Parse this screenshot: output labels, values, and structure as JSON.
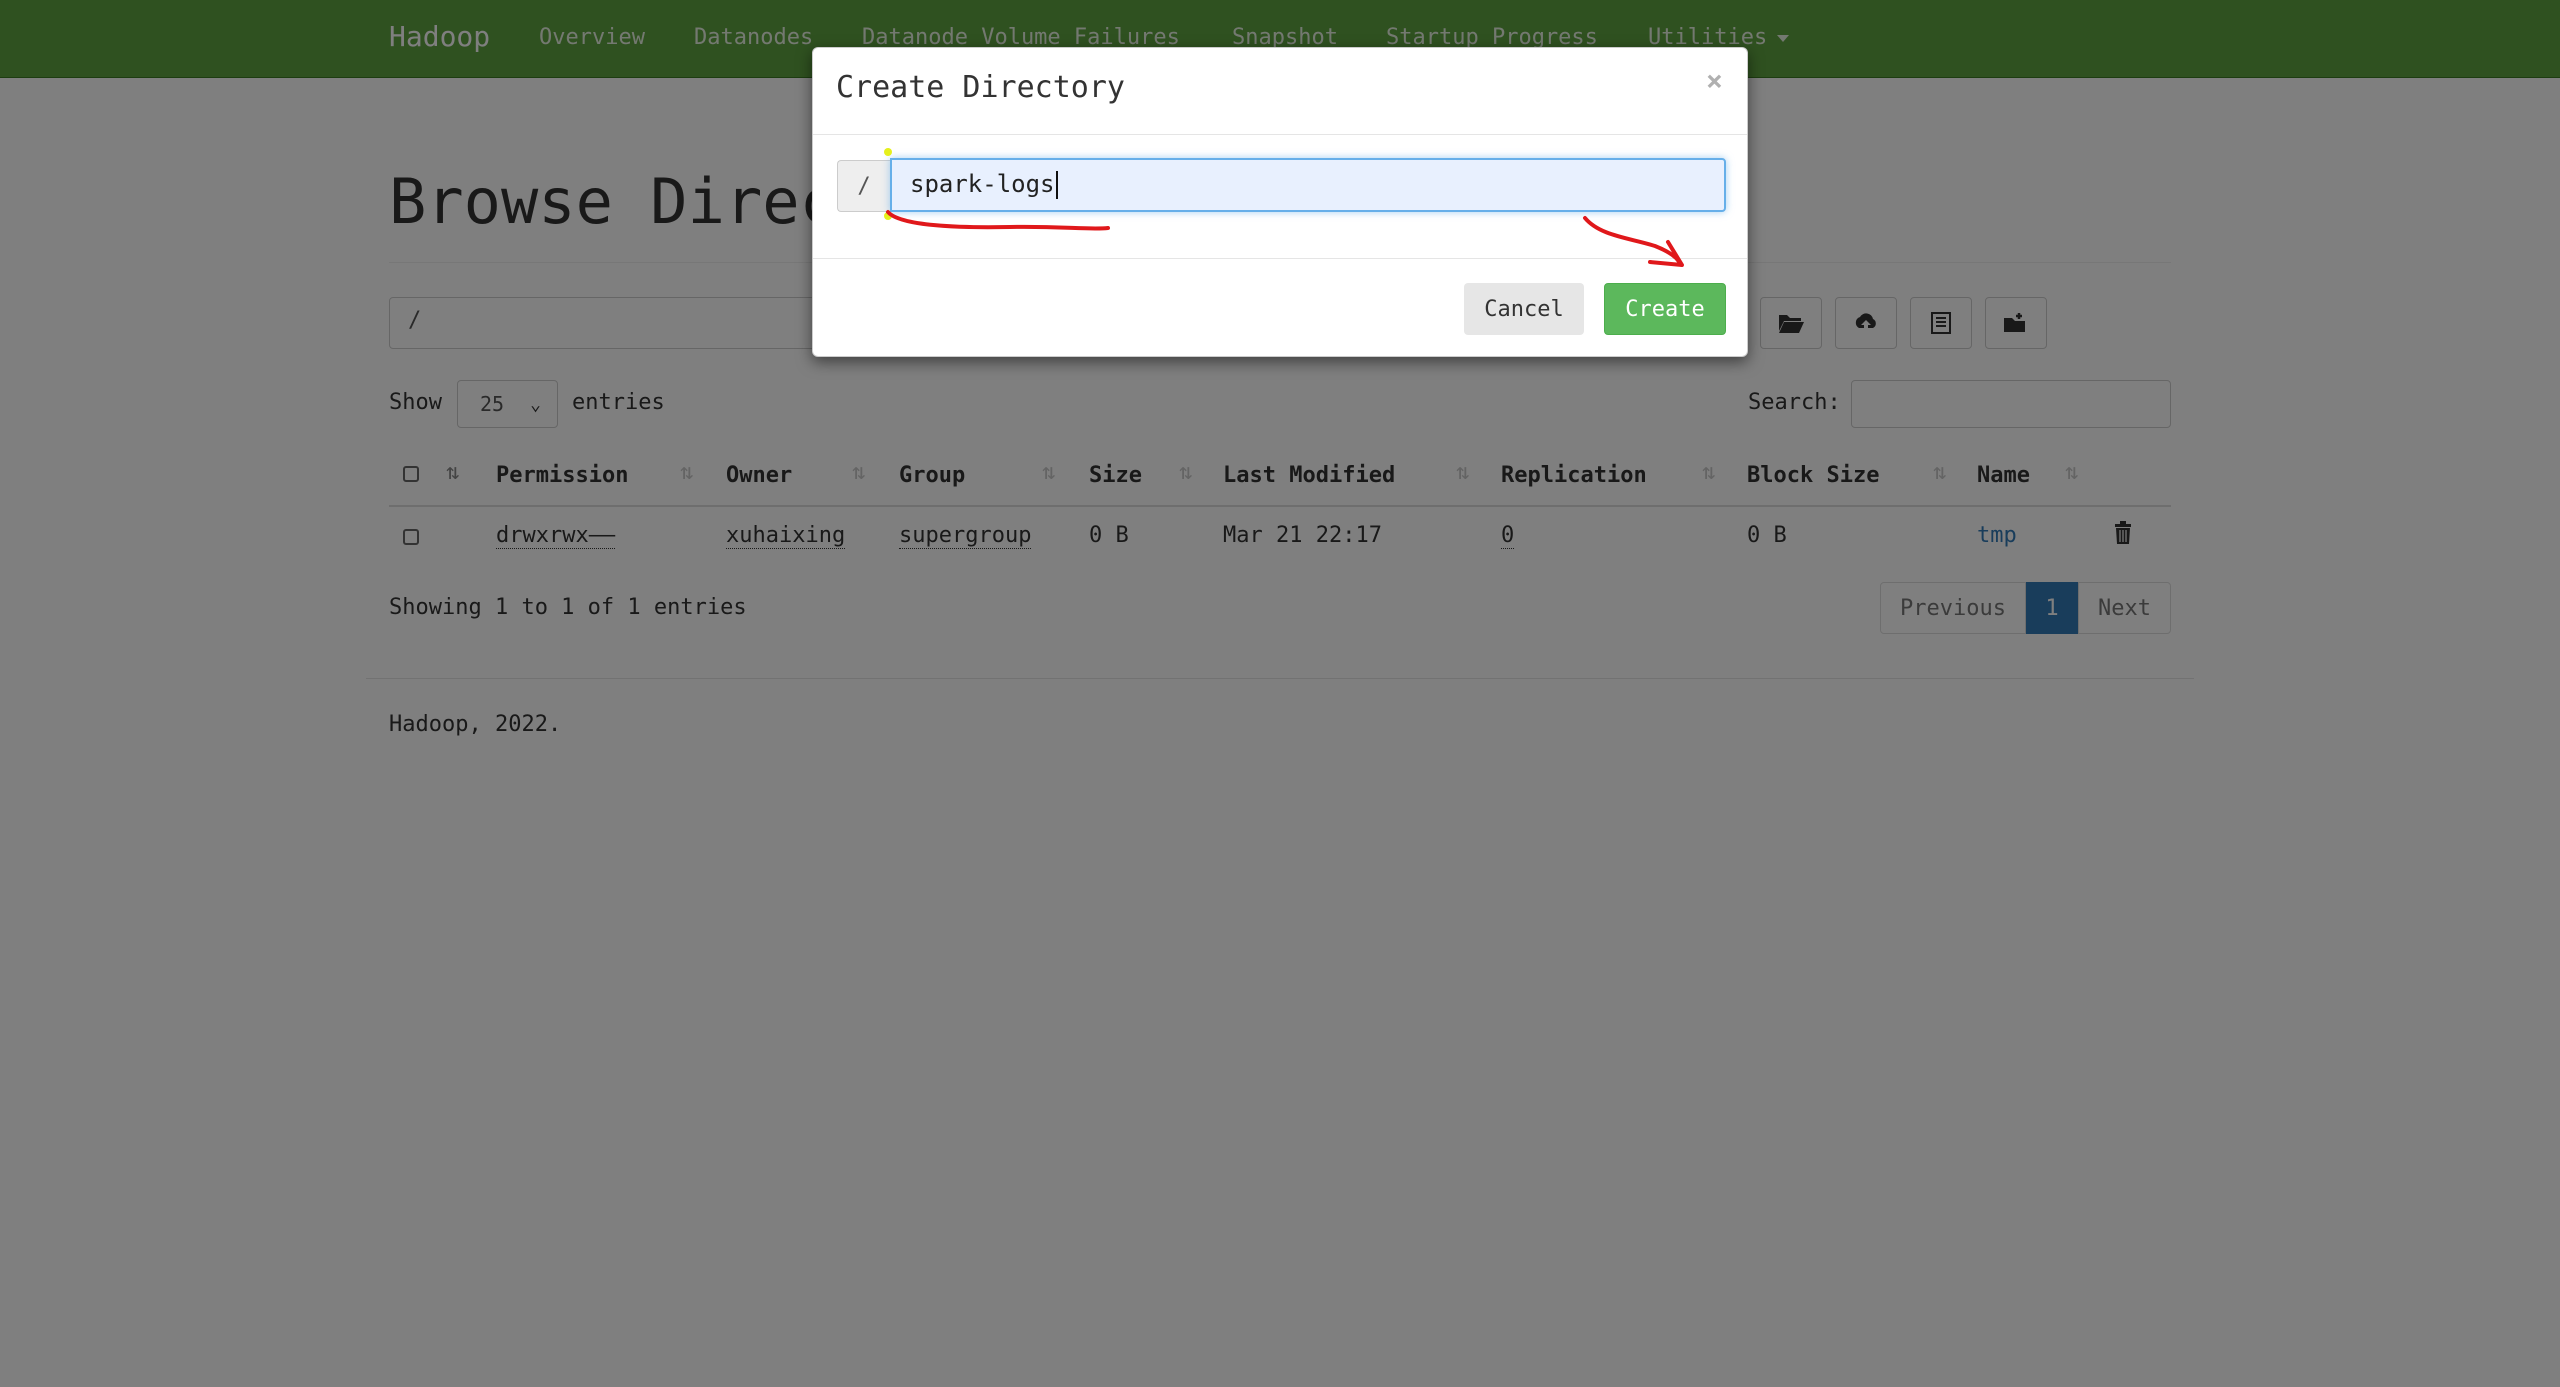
{
  "navbar": {
    "brand": "Hadoop",
    "items": [
      "Overview",
      "Datanodes",
      "Datanode Volume Failures",
      "Snapshot",
      "Startup Progress",
      "Utilities"
    ]
  },
  "page": {
    "title": "Browse Directory",
    "path_value": "/",
    "toolbar_icons": [
      "folder-open-icon",
      "upload-icon",
      "list-icon",
      "paste-icon"
    ]
  },
  "table_controls": {
    "show_label": "Show",
    "length_value": "25",
    "entries_label": "entries",
    "search_label": "Search:"
  },
  "table": {
    "columns": [
      "Permission",
      "Owner",
      "Group",
      "Size",
      "Last Modified",
      "Replication",
      "Block Size",
      "Name"
    ],
    "rows": [
      {
        "permission": "drwxrwx——",
        "owner": "xuhaixing",
        "group": "supergroup",
        "size": "0 B",
        "last_modified": "Mar 21 22:17",
        "replication": "0",
        "block_size": "0 B",
        "name": "tmp"
      }
    ]
  },
  "info": "Showing 1 to 1 of 1 entries",
  "pagination": {
    "previous": "Previous",
    "current": "1",
    "next": "Next"
  },
  "footer": "Hadoop, 2022.",
  "modal": {
    "title": "Create Directory",
    "close": "×",
    "path_prefix": "/",
    "input_value": "spark-logs",
    "cancel": "Cancel",
    "create": "Create"
  },
  "colors": {
    "navbar": "#5fa341",
    "create_button": "#5cb85c",
    "link": "#337ab7",
    "annotation": "#e0181b"
  }
}
